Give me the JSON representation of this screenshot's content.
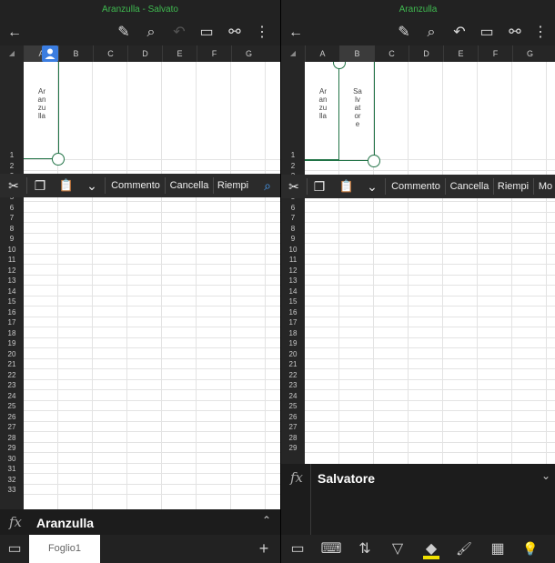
{
  "left": {
    "title": "Aranzulla - Salvato",
    "columns": [
      "A",
      "B",
      "C",
      "D",
      "E",
      "F",
      "G"
    ],
    "rows": [
      "1",
      "2",
      "3",
      "4",
      "5",
      "6",
      "7",
      "8",
      "9",
      "10",
      "11",
      "12",
      "13",
      "14",
      "15",
      "16",
      "17",
      "18",
      "19",
      "20",
      "21",
      "22",
      "23",
      "24",
      "25",
      "26",
      "27",
      "28",
      "29",
      "30",
      "31",
      "32",
      "33"
    ],
    "cell_a1": "Aranzulla",
    "context_menu": {
      "comment": "Commento",
      "delete": "Cancella",
      "fill": "Riempi"
    },
    "formula_value": "Aranzulla",
    "sheet_tab": "Foglio1",
    "add_sheet": "+"
  },
  "right": {
    "title": "Aranzulla",
    "columns": [
      "A",
      "B",
      "C",
      "D",
      "E",
      "F",
      "G"
    ],
    "rows": [
      "1",
      "2",
      "3",
      "4",
      "5",
      "6",
      "7",
      "8",
      "9",
      "10",
      "11",
      "12",
      "13",
      "14",
      "15",
      "16",
      "17",
      "18",
      "19",
      "20",
      "21",
      "22",
      "23",
      "24",
      "25",
      "26",
      "27",
      "28",
      "29"
    ],
    "cell_a1": "Aranzulla",
    "cell_b1": "Salvatore",
    "context_menu": {
      "comment": "Commento",
      "delete": "Cancella",
      "fill": "Riempi",
      "more": "Mo"
    },
    "formula_value": "Salvatore"
  },
  "icons": {
    "back": "←",
    "draw": "✎",
    "search": "⌕",
    "undo": "↶",
    "comment": "▭",
    "share": "⚯",
    "more": "⋮",
    "cut": "✂",
    "copy": "❐",
    "paste": "📋",
    "chevron_down": "⌄",
    "chevron_up": "⌃",
    "fx": "fx",
    "corner": "◢",
    "keyboard": "⌨",
    "filter": "▽",
    "fill_color": "◆",
    "brush": "🖌",
    "table": "▦",
    "lightbulb": "💡",
    "sort": "⇅",
    "display": "▭"
  },
  "colors": {
    "accent": "#217346",
    "title_green": "#3fb950",
    "highlight_yellow": "#f2e200"
  }
}
